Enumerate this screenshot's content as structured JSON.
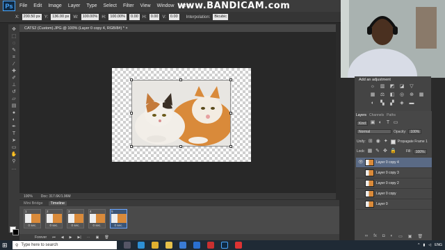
{
  "app": {
    "logo": "Ps",
    "recorder_watermark": "www.BANDICAM.com"
  },
  "menu": [
    "File",
    "Edit",
    "Image",
    "Layer",
    "Type",
    "Select",
    "Filter",
    "View",
    "Window",
    "Help"
  ],
  "options": {
    "x_label": "X:",
    "x_value": "200.50 px",
    "y_label": "Y:",
    "y_value": "136.00 px",
    "w_label": "W:",
    "w_value": "100.00%",
    "h_label": "H:",
    "h_value": "100.00%",
    "angle_value": "0.00",
    "hskew_label": "H:",
    "hskew_value": "0.00",
    "vskew_label": "V:",
    "vskew_value": "0.00",
    "interp_label": "Interpolation:",
    "interp_value": "Bicubic"
  },
  "document": {
    "tab_title": "CATS2 (Custom).JPG @ 100% (Layer 0 copy 4, RGB/8#) *  ×"
  },
  "status": {
    "zoom": "100%",
    "doc_info": "Doc: 317.6K/1.96M"
  },
  "timeline": {
    "tabs": [
      "Mini Bridge",
      "Timeline"
    ],
    "frames": [
      {
        "num": "1",
        "delay": "0 sec."
      },
      {
        "num": "2",
        "delay": "0 sec."
      },
      {
        "num": "3",
        "delay": "0 sec."
      },
      {
        "num": "4",
        "delay": "0 sec."
      },
      {
        "num": "5",
        "delay": "0 sec."
      }
    ],
    "loop": "Forever"
  },
  "adjustments": {
    "title": "Add an adjustment"
  },
  "layers": {
    "tabs": [
      "Layers",
      "Channels",
      "Paths"
    ],
    "kind_label": "Kind",
    "blend_mode": "Normal",
    "opacity_label": "Opacity:",
    "opacity_value": "100%",
    "unify_label": "Unify:",
    "propagate_label": "Propagate Frame 1",
    "lock_label": "Lock:",
    "fill_label": "Fill:",
    "fill_value": "100%",
    "items": [
      "Layer 0 copy 4",
      "Layer 0 copy 3",
      "Layer 0 copy 2",
      "Layer 0 copy",
      "Layer 0"
    ]
  },
  "taskbar": {
    "search_placeholder": "Type here to search",
    "tray_lang": "ENG"
  },
  "colors": {
    "accent": "#4aa8ff",
    "selection": "#5a6a85"
  }
}
